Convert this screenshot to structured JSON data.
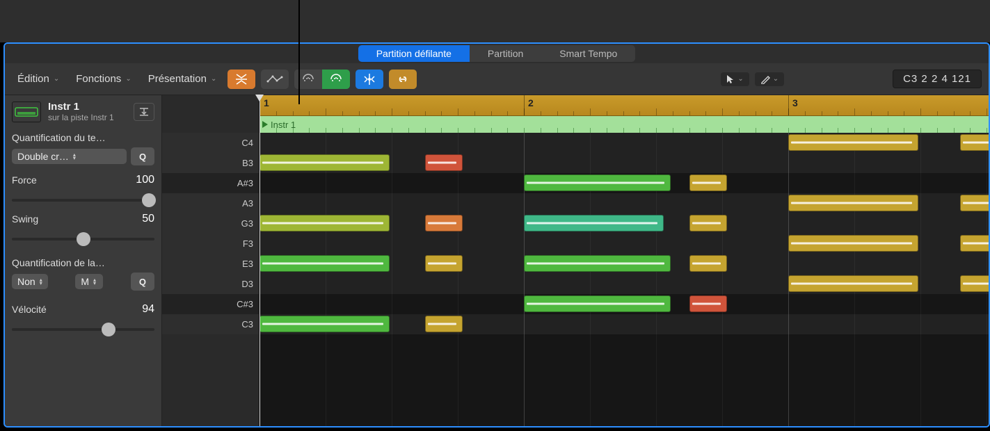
{
  "tabs": {
    "scroll": "Partition défilante",
    "score": "Partition",
    "tempo": "Smart Tempo"
  },
  "toolbar": {
    "edit": "Édition",
    "functions": "Fonctions",
    "view": "Présentation"
  },
  "info_display": "C3   2 2 4 121",
  "track": {
    "name": "Instr 1",
    "subtitle": "sur la piste Instr 1"
  },
  "inspector": {
    "time_quant_label": "Quantification du te…",
    "time_quant_value": "Double cr…",
    "q_button": "Q",
    "strength_label": "Force",
    "strength_value": "100",
    "swing_label": "Swing",
    "swing_value": "50",
    "scale_quant_label": "Quantification de la…",
    "scale_quant_value": "Non",
    "scale_quant_value2": "M",
    "velocity_label": "Vélocité",
    "velocity_value": "94"
  },
  "region_name": "Instr 1",
  "ruler_bars": [
    "1",
    "2",
    "3"
  ],
  "note_labels": [
    "C4",
    "B3",
    "A#3",
    "A3",
    "G3",
    "F3",
    "E3",
    "D3",
    "C#3",
    "C3"
  ],
  "colors": {
    "green": "#4fb83f",
    "yellow": "#c5a430",
    "olive": "#9eb635",
    "red": "#d0543b",
    "teal": "#3fb888",
    "orange": "#d87a3a"
  }
}
